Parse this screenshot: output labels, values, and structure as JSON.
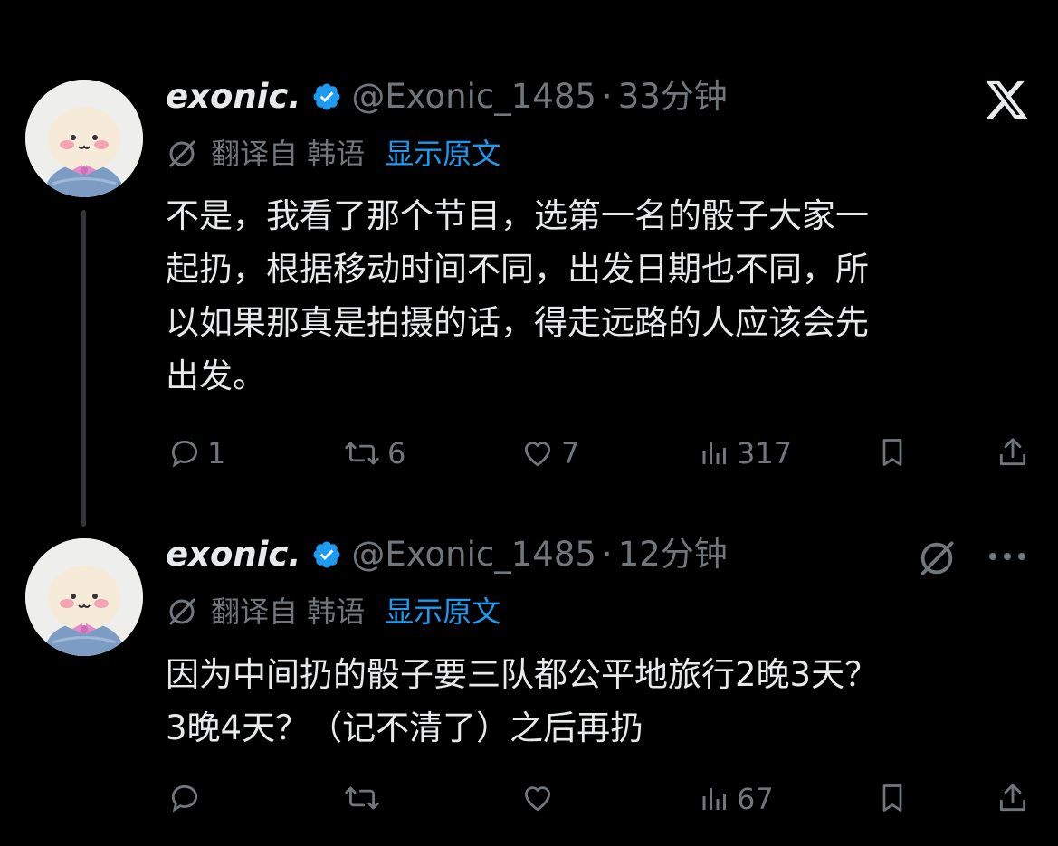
{
  "app": {
    "logo": "x-logo-icon"
  },
  "tweets": [
    {
      "author": {
        "name": "exonic.",
        "handle": "@Exonic_1485",
        "verified": true
      },
      "time": "33分钟",
      "translation": {
        "label": "翻译自 韩语",
        "show_original": "显示原文"
      },
      "text": "不是，我看了那个节目，选第一名的骰子大家一\n起扔，根据移动时间不同，出发日期也不同，所\n以如果那真是拍摄的话，得走远路的人应该会先\n出发。",
      "actions": {
        "replies": "1",
        "reposts": "6",
        "likes": "7",
        "views": "317"
      }
    },
    {
      "author": {
        "name": "exonic.",
        "handle": "@Exonic_1485",
        "verified": true
      },
      "time": "12分钟",
      "translation": {
        "label": "翻译自 韩语",
        "show_original": "显示原文"
      },
      "text": "因为中间扔的骰子要三队都公平地旅行2晚3天？\n3晚4天？（记不清了）之后再扔",
      "actions": {
        "replies": "",
        "reposts": "",
        "likes": "",
        "views": "67"
      }
    }
  ],
  "colors": {
    "background": "#000000",
    "text": "#e7e9ea",
    "muted": "#71767b",
    "link": "#1d9bf0",
    "verified": "#1d9bf0"
  }
}
